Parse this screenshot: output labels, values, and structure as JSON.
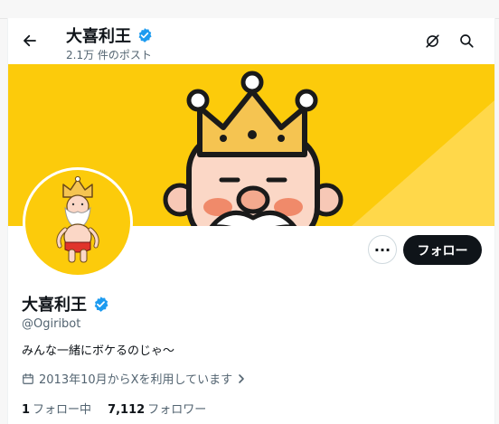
{
  "header": {
    "title": "大喜利王",
    "post_count": "2.1万 件のポスト"
  },
  "profile": {
    "name": "大喜利王",
    "handle": "@Ogiribot",
    "bio": "みんな一緒にボケるのじゃ～",
    "joined": "2013年10月からXを利用しています",
    "following_count": "1",
    "following_label": "フォロー中",
    "followers_count": "7,112",
    "followers_label": "フォロワー"
  },
  "actions": {
    "more_label": "···",
    "follow_label": "フォロー"
  },
  "colors": {
    "accent": "#1d9bf0",
    "banner": "#fccb0b",
    "dark": "#0f1419",
    "muted": "#536471"
  },
  "icons": {
    "back": "arrow-left-icon",
    "verified": "verified-badge-icon",
    "grok": "grok-icon",
    "search": "search-icon",
    "calendar": "calendar-icon"
  }
}
